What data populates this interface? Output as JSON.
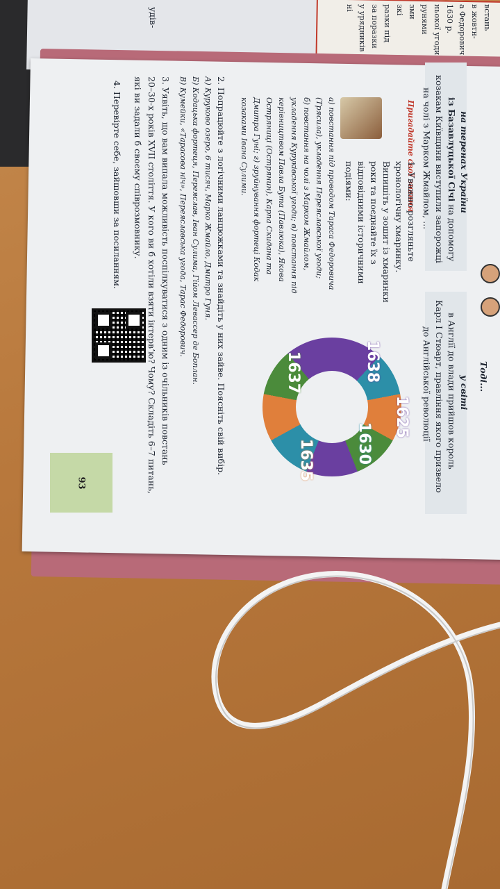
{
  "page": {
    "number": "93",
    "header_left": "на теренах України",
    "header_right_top": "Тоді...",
    "header_right": "у світі",
    "sich_line1": "із Базавлуцької Січі",
    "sich_line1_tail": "на допомогу",
    "sich_line2": "козакам Київщини виступили запорожці",
    "sich_line3": "на чолі з Марком Жмайлом, ...",
    "world_line1": "в Англії до влади прийшов король",
    "world_line2": "Карл I Стюарт, правління якого призвело",
    "world_line3": "до Англійської революції",
    "tip_label": "Пригадайте свої знання",
    "task1_line1": "1. Уважно розгляньте",
    "task1_line2": "хронологічну хмаринку.",
    "task1_line3": "Випишіть у зошит із хмаринки",
    "task1_line4": "роки та поєднайте їх з",
    "task1_line5": "відповідними історичними",
    "task1_line6": "подіями:",
    "task1_a": "а) повстання під проводом Тараса Федоровича",
    "task1_a2": "(Трясила), укладення Переяславської угоди;",
    "task1_b": "б) повстання на чолі з Марком Жмайлом,",
    "task1_b2": "укладення Куруківської угоди; в) повстання під",
    "task1_b3": "керівництвом Павла Бута (Павлюка), Якова",
    "task1_b4": "Остряниці (Острянин), Карпа Скидана та",
    "task1_b5": "Дмитра Гуні; г) зруйнування фортеці Кодак",
    "task1_b6": "козаками Івана Сулими.",
    "task2_line1": "2. Попрацюйте з логічними ланцюжками та знайдіть у них зайве. Поясніть свій вибір.",
    "task2_a": "А) Куруково озеро, 6 тисяч, Марко Жмайло, Дмитро Гуня.",
    "task2_b": "Б) Кодацька фортеця, Переяслав, Іван Сулима, Гійом Левассер де Боплан.",
    "task2_c": "В) Кумейки, «Тарасова ніч», Переяславська угода, Тарас Федорович.",
    "task3_line1": "3. Уявіть, що вам випала можливість поспілкуватися з одним із очільників повстань",
    "task3_line2": "20–30-х років XVII століття. У кого ви б хотіли взяти інтерв’ю? Чому? Складіть 6–7 питань,",
    "task3_line3": "які ви задали б своєму співрозмовнику.",
    "task4_line1": "4. Перевірте себе, зайшовши за посиланням.",
    "prev_page_fragment": "удів-",
    "prev_box_lines": [
      "встань",
      "в жовтн-",
      "а Федорович",
      "1630 р.",
      "ньокої угоди",
      "рунями",
      "зми",
      "зкі",
      "разки під",
      "за поразки",
      "у урядників",
      "ні"
    ]
  },
  "wordcloud": {
    "years": [
      "1625",
      "1630",
      "1635",
      "1637",
      "1638"
    ],
    "colors": [
      "#6a3fa0",
      "#2c8fa8",
      "#e07f3b",
      "#4b8b3b"
    ]
  }
}
